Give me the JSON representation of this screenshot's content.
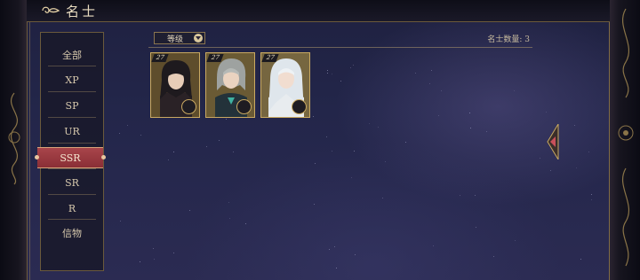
{
  "header": {
    "title": "名士"
  },
  "sidebar": {
    "items": [
      {
        "label": "全部",
        "active": false
      },
      {
        "label": "XP",
        "active": false
      },
      {
        "label": "SP",
        "active": false
      },
      {
        "label": "UR",
        "active": false
      },
      {
        "label": "SSR",
        "active": true
      },
      {
        "label": "SR",
        "active": false
      },
      {
        "label": "R",
        "active": false
      },
      {
        "label": "信物",
        "active": false
      }
    ]
  },
  "toolbar": {
    "sort_label": "等级",
    "count_text": "名士数量: 3"
  },
  "cards": [
    {
      "level": "27",
      "portrait": "dark-haired-character"
    },
    {
      "level": "27",
      "portrait": "silver-haired-character"
    },
    {
      "level": "27",
      "portrait": "white-haired-character"
    }
  ],
  "colors": {
    "accent_gold": "#c9a961",
    "active_tab": "#9a3a40",
    "text": "#d7c9ad"
  }
}
